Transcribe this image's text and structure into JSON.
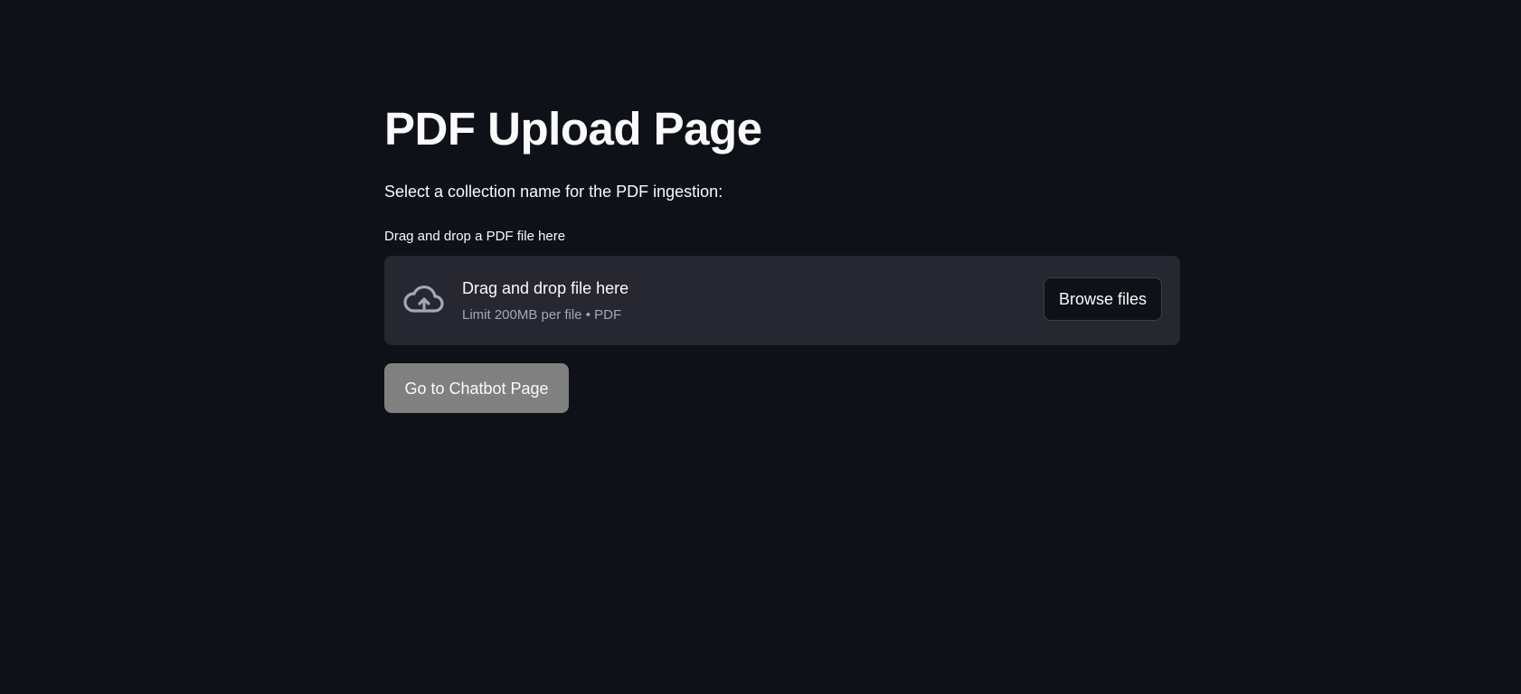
{
  "page": {
    "title": "PDF Upload Page",
    "subtitle": "Select a collection name for the PDF ingestion:"
  },
  "uploader": {
    "label": "Drag and drop a PDF file here",
    "drop_text": "Drag and drop file here",
    "limit_text": "Limit 200MB per file • PDF",
    "browse_label": "Browse files",
    "icon": "cloud-upload-icon"
  },
  "actions": {
    "chatbot_label": "Go to Chatbot Page"
  },
  "colors": {
    "background": "#0e1117",
    "dropzone": "#262730",
    "text": "#fafafa",
    "muted_text": "#a3a8b8",
    "chatbot_button": "#808080"
  }
}
